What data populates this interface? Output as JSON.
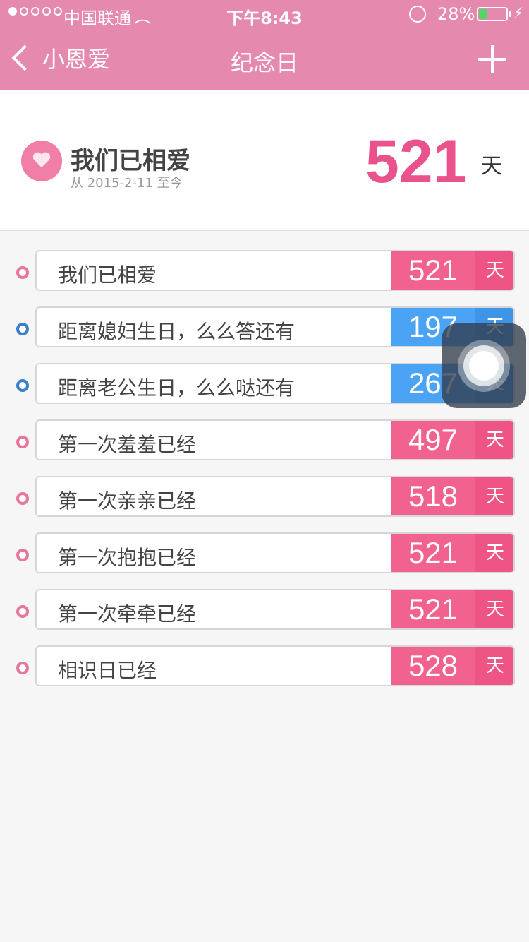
{
  "status_bar": {
    "carrier": "中国联通",
    "time": "下午8:43",
    "battery_percent": "28%",
    "battery_level": 0.28,
    "signal_bars": 1,
    "signal_total": 5
  },
  "nav": {
    "back_label": "小恩爱",
    "title": "纪念日"
  },
  "summary": {
    "title": "我们已相爱",
    "subtitle": "从 2015-2-11 至今",
    "count": "521",
    "unit": "天"
  },
  "colors": {
    "header": "#e58aae",
    "pink": "#f2628f",
    "pink_unit": "#ee5585",
    "blue": "#4ba3f5",
    "blue_unit": "#3e95e8",
    "dot_pink": "#e8769b",
    "dot_blue": "#3a7fc8"
  },
  "events": [
    {
      "label": "我们已相爱",
      "count": "521",
      "unit": "天",
      "type": "pink"
    },
    {
      "label": "距离媳妇生日，么么答还有",
      "count": "197",
      "unit": "天",
      "type": "blue"
    },
    {
      "label": "距离老公生日，么么哒还有",
      "count": "267",
      "unit": "天",
      "type": "blue"
    },
    {
      "label": "第一次羞羞已经",
      "count": "497",
      "unit": "天",
      "type": "pink"
    },
    {
      "label": "第一次亲亲已经",
      "count": "518",
      "unit": "天",
      "type": "pink"
    },
    {
      "label": "第一次抱抱已经",
      "count": "521",
      "unit": "天",
      "type": "pink"
    },
    {
      "label": "第一次牵牵已经",
      "count": "521",
      "unit": "天",
      "type": "pink"
    },
    {
      "label": "相识日已经",
      "count": "528",
      "unit": "天",
      "type": "pink"
    }
  ]
}
